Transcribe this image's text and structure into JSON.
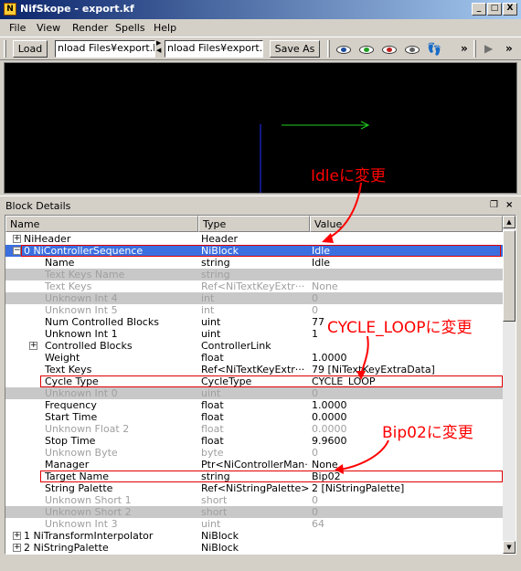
{
  "window": {
    "title": "NifSkope - export.kf",
    "minimize": "_",
    "maximize": "□",
    "close": "X"
  },
  "menu": [
    "File",
    "View",
    "Render",
    "Spells",
    "Help"
  ],
  "toolbar": {
    "load_label": "Load",
    "load_path": "nload Files¥export.kf",
    "save_path": "nload Files¥export.kf",
    "save_label": "Save As",
    "more1": "»",
    "more2": "»",
    "play_icon": "▶"
  },
  "annotations": {
    "idle": "Idleに変更",
    "cycle": "CYCLE_LOOPに変更",
    "bip": "Bip02に変更"
  },
  "dock": {
    "title": "Block Details",
    "float_icon": "❐",
    "close_icon": "×"
  },
  "columns": [
    "Name",
    "Type",
    "Value"
  ],
  "rows": [
    {
      "name": "NiHeader",
      "type": "Header",
      "value": "",
      "indent": 0,
      "expander": "+",
      "style": ""
    },
    {
      "name": "0  NiControllerSequence",
      "type": "NiBlock",
      "value": "Idle",
      "indent": 0,
      "expander": "−",
      "style": "sel"
    },
    {
      "name": "Name",
      "type": "string",
      "value": "Idle",
      "indent": 1,
      "expander": "",
      "style": ""
    },
    {
      "name": "Text Keys Name",
      "type": "string",
      "value": "",
      "indent": 1,
      "expander": "",
      "style": "gray dim"
    },
    {
      "name": "Text Keys",
      "type": "Ref<NiTextKeyExtr···",
      "value": "None",
      "indent": 1,
      "expander": "",
      "style": "dim"
    },
    {
      "name": "Unknown Int 4",
      "type": "int",
      "value": "0",
      "indent": 1,
      "expander": "",
      "style": "gray dim"
    },
    {
      "name": "Unknown Int 5",
      "type": "int",
      "value": "0",
      "indent": 1,
      "expander": "",
      "style": "dim"
    },
    {
      "name": "Num Controlled Blocks",
      "type": "uint",
      "value": "77",
      "indent": 1,
      "expander": "",
      "style": ""
    },
    {
      "name": "Unknown Int 1",
      "type": "uint",
      "value": "1",
      "indent": 1,
      "expander": "",
      "style": ""
    },
    {
      "name": "Controlled Blocks",
      "type": "ControllerLink",
      "value": "",
      "indent": 1,
      "expander": "+",
      "style": ""
    },
    {
      "name": "Weight",
      "type": "float",
      "value": "1.0000",
      "indent": 1,
      "expander": "",
      "style": ""
    },
    {
      "name": "Text Keys",
      "type": "Ref<NiTextKeyExtr···",
      "value": "79 [NiTextKeyExtraData]",
      "indent": 1,
      "expander": "",
      "style": ""
    },
    {
      "name": "Cycle Type",
      "type": "CycleType",
      "value": "CYCLE_LOOP",
      "indent": 1,
      "expander": "",
      "style": ""
    },
    {
      "name": "Unknown Int 0",
      "type": "uint",
      "value": "0",
      "indent": 1,
      "expander": "",
      "style": "gray dim"
    },
    {
      "name": "Frequency",
      "type": "float",
      "value": "1.0000",
      "indent": 1,
      "expander": "",
      "style": ""
    },
    {
      "name": "Start Time",
      "type": "float",
      "value": "0.0000",
      "indent": 1,
      "expander": "",
      "style": ""
    },
    {
      "name": "Unknown Float 2",
      "type": "float",
      "value": "0.0000",
      "indent": 1,
      "expander": "",
      "style": "dim"
    },
    {
      "name": "Stop Time",
      "type": "float",
      "value": "9.9600",
      "indent": 1,
      "expander": "",
      "style": ""
    },
    {
      "name": "Unknown Byte",
      "type": "byte",
      "value": "0",
      "indent": 1,
      "expander": "",
      "style": "dim"
    },
    {
      "name": "Manager",
      "type": "Ptr<NiControllerMan···",
      "value": "None",
      "indent": 1,
      "expander": "",
      "style": ""
    },
    {
      "name": "Target Name",
      "type": "string",
      "value": "Bip02",
      "indent": 1,
      "expander": "",
      "style": ""
    },
    {
      "name": "String Palette",
      "type": "Ref<NiStringPalette>",
      "value": "2 [NiStringPalette]",
      "indent": 1,
      "expander": "",
      "style": ""
    },
    {
      "name": "Unknown Short 1",
      "type": "short",
      "value": "0",
      "indent": 1,
      "expander": "",
      "style": "dim"
    },
    {
      "name": "Unknown Short 2",
      "type": "short",
      "value": "0",
      "indent": 1,
      "expander": "",
      "style": "gray dim"
    },
    {
      "name": "Unknown Int 3",
      "type": "uint",
      "value": "64",
      "indent": 1,
      "expander": "",
      "style": "dim"
    },
    {
      "name": "1  NiTransformInterpolator",
      "type": "NiBlock",
      "value": "",
      "indent": 0,
      "expander": "+",
      "style": ""
    },
    {
      "name": "2  NiStringPalette",
      "type": "NiBlock",
      "value": "",
      "indent": 0,
      "expander": "+",
      "style": ""
    }
  ]
}
